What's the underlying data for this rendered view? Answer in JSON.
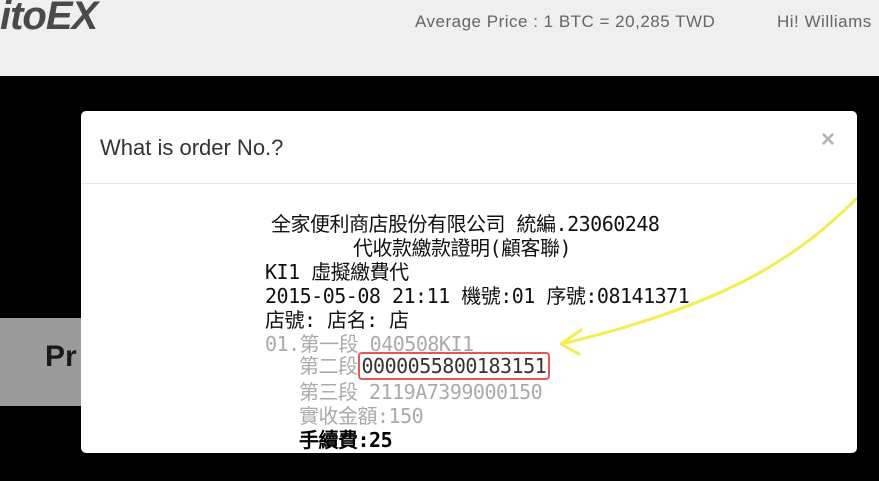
{
  "header": {
    "logo": "itoEX",
    "average_price": "Average Price : 1 BTC = 20,285 TWD",
    "greeting": "Hi! Williams"
  },
  "background": {
    "panel_text": "Pr"
  },
  "modal": {
    "title": "What is order No.?",
    "close": "×",
    "receipt": {
      "line1": "全家便利商店股份有限公司 統編.23060248",
      "line2": "代收款繳款證明(顧客聯)",
      "line3": "KI1  虛擬繳費代",
      "line4": "2015-05-08 21:11 機號:01 序號:08141371",
      "line5": "店號:      店名:     店",
      "line6": "01.第一段 040508KI1",
      "line7_label": "第二段",
      "line7_value": "0000055800183151",
      "line8": "第三段 2119A7399000150",
      "line9": "實收金額:150",
      "line10": "手續費:25"
    },
    "colors": {
      "highlight_box": "#e55656",
      "arrow": "#f2ee4f"
    }
  }
}
